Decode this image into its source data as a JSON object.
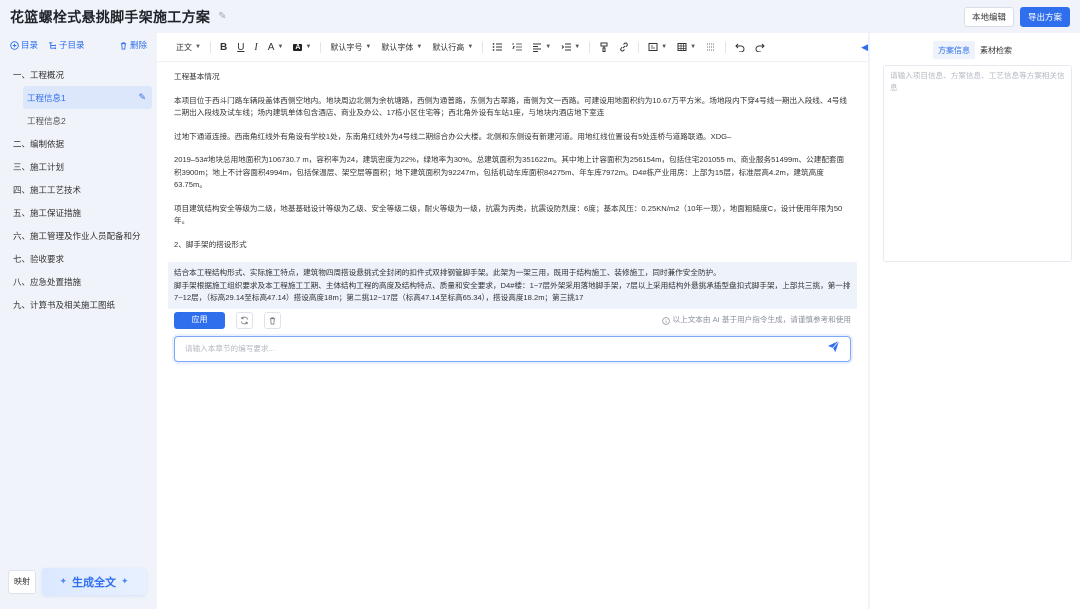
{
  "header": {
    "title": "花篮螺栓式悬挑脚手架施工方案",
    "local_edit_label": "本地编辑",
    "export_label": "导出方案"
  },
  "sidebar": {
    "tools": {
      "toc": "目录",
      "sub_toc": "子目录",
      "delete": "删除"
    },
    "items": [
      {
        "label": "一、工程概况"
      },
      {
        "label": "二、编制依据"
      },
      {
        "label": "三、施工计划"
      },
      {
        "label": "四、施工工艺技术"
      },
      {
        "label": "五、施工保证措施"
      },
      {
        "label": "六、施工管理及作业人员配备和分"
      },
      {
        "label": "七、验收要求"
      },
      {
        "label": "八、应急处置措施"
      },
      {
        "label": "九、计算书及相关施工图纸"
      }
    ],
    "sub_items": [
      {
        "label": "工程信息1",
        "active": true
      },
      {
        "label": "工程信息2",
        "active": false
      }
    ],
    "map_label": "映射",
    "generate_label": "生成全文"
  },
  "toolbar": {
    "paragraph": "正文",
    "font_size": "默认字号",
    "font_family": "默认字体",
    "line_height": "默认行高"
  },
  "content": {
    "heading1": "工程基本情况",
    "p1": "本项目位于西斗门路车辆段盖体西侧空地内。地块周边北侧为余杭塘路，西侧为通普路，东侧为古翠路，南侧为文一西路。可建设用地面积约为10.67万平方米。场地段内下穿4号线一期出入段线、4号线二期出入段线及试车线；场内建筑单体包含酒店、商业及办公、17栋小区住宅等；西北角外设有车站1座，与地块内酒店地下室连",
    "p2": "过地下通道连接。西南角红线外有角设有学校1处，东南角红线外为4号线二期综合办公大楼。北侧和东侧设有新建河道。用地红线位置设有5处连桥与道路联通。XDG–",
    "p3": "2019–53#地块总用地面积为106730.7 m，容积率为24，建筑密度为22%，绿地率为30%。总建筑面积为351622m。其中地上计容面积为256154m，包括住宅201055 m、商业服务51499m、公建配套面积3900m；地上不计容面积4994m，包括保温层、架空层等面积；地下建筑面积为92247m，包括机动车库面积84275m、年车库7972m。D4#栋产业用房：上部为15层，标准层高4.2m，建筑高度63.75m。",
    "p4": "项目建筑结构安全等级为二级，地基基础设计等级为乙级、安全等级二级，耐火等级为一级，抗震为丙类，抗震设防烈度：6度；基本风压：0.25KN/m2（10年一现），地面粗糙度C，设计使用年限为50年。",
    "heading2": "2、脚手架的搭设形式",
    "ai_text1": "结合本工程结构形式、实际施工特点，建筑物四周搭设悬挑式全封闭的扣件式双排钢管脚手架。此架为一架三用，既用于结构施工、装修施工，同时兼作安全防护。",
    "ai_text2": "脚手架根据施工组织要求及本工程施工工期、主体结构工程的高度及结构特点、质量和安全要求，D4#楼：1~7层外架采用落地脚手架，7层以上采用结构外悬挑承插型盘扣式脚手架，上部共三挑，第一排7~12层，（标高29.14至标高47.14）搭设高度18m；第二挑12~17层（标高47.14至标高65.34），搭设高度18.2m；第三挑17",
    "apply_label": "应用",
    "ai_notice": "以上文本由 AI 基于用户指令生成，请谨慎参考和使用",
    "prompt_placeholder": "请输入本章节的编写要求..."
  },
  "right_panel": {
    "tabs": [
      {
        "label": "方案信息",
        "active": true
      },
      {
        "label": "素材检索",
        "active": false
      }
    ],
    "textarea_placeholder": "请输入项目信息、方案信息、工艺信息等方案相关信息"
  },
  "colors": {
    "accent": "#2f6fed",
    "background": "#f0f3f9",
    "ai_block": "#edf2fb"
  }
}
